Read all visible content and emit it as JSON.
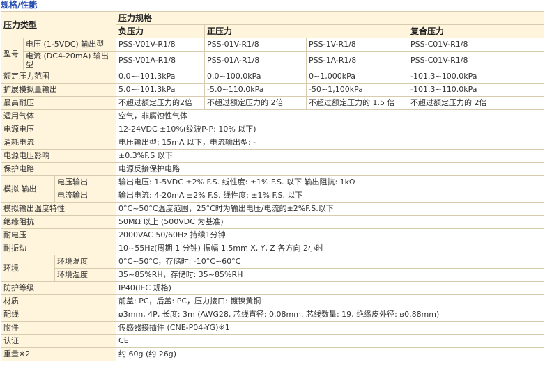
{
  "title": "规格/性能",
  "header": {
    "pressure_type": "压力类型",
    "pressure_spec": "压力规格",
    "negative": "负压力",
    "positive": "正压力",
    "compound": "复合压力"
  },
  "model": {
    "label": "型号",
    "voltage_label": "电压 (1-5VDC) 输出型",
    "current_label": "电流 (DC4-20mA) 输出型",
    "voltage": [
      "PSS-V01V-R1/8",
      "PSS-01V-R1/8",
      "PSS-1V-R1/8",
      "PSS-C01V-R1/8"
    ],
    "current": [
      "PSS-V01A-R1/8",
      "PSS-01A-R1/8",
      "PSS-1A-R1/8",
      "PSS-C01V-R1/8"
    ]
  },
  "rated_range": {
    "label": "额定压力范围",
    "values": [
      "0.0~-101.3kPa",
      "0.0~100.0kPa",
      "0~1,000kPa",
      "-101.3~100.0kPa"
    ]
  },
  "ext_output": {
    "label": "扩展模拟量输出",
    "values": [
      "5.0~-101.3kPa",
      "-5.0~110.0kPa",
      "-50~1,100kPa",
      "-101.3~110.0kPa"
    ]
  },
  "max_pressure": {
    "label": "最高耐压",
    "values": [
      "不超过额定压力的2倍",
      "不超过额定压力的 2倍",
      "不超过额定压力的 1.5 倍",
      "不超过额定压力的 2倍"
    ]
  },
  "gas": {
    "label": "适用气体",
    "value": "空气，非腐蚀性气体"
  },
  "supply_voltage": {
    "label": "电源电压",
    "value": "12-24VDC ±10%(纹波P-P: 10% 以下)"
  },
  "current_consumption": {
    "label": "消耗电流",
    "value": "电压输出型: 15mA 以下，电流输出型: -"
  },
  "supply_effect": {
    "label": "电源电压影响",
    "value": "±0.3%F.S 以下"
  },
  "protection_circuit": {
    "label": "保护电路",
    "value": "电源反接保护电路"
  },
  "analog_output": {
    "label": "模拟 输出",
    "voltage_label": "电压输出",
    "current_label": "电流输出",
    "voltage_value": "输出电压: 1-5VDC ±2% F.S. 线性度: ±1% F.S. 以下 输出阻抗: 1kΩ",
    "current_value": "输出电流: 4-20mA ±2% F.S. 线性度: ±1% F.S. 以下"
  },
  "temp_char": {
    "label": "模拟输出温度特性",
    "value": "0°C~50°C温度范围，25°C时为输出电压/电流的±2%F.S.以下"
  },
  "insulation": {
    "label": "绝缘阻抗",
    "value": "50MΩ 以上 (500VDC 为基准)"
  },
  "withstand": {
    "label": "耐电压",
    "value": "2000VAC 50/60Hz 持续1分钟"
  },
  "vibration": {
    "label": "耐振动",
    "value": "10~55Hz(周期 1 分钟) 振幅 1.5mm X, Y, Z 各方向 2小时"
  },
  "environment": {
    "label": "环境",
    "temp_label": "环境温度",
    "humidity_label": "环境湿度",
    "temp_value": "0°C~50°C，存储时: -10°C~60°C",
    "humidity_value": "35~85%RH，存储时: 35~85%RH"
  },
  "protection_grade": {
    "label": "防护等级",
    "value": "IP40(IEC 规格)"
  },
  "material": {
    "label": "材质",
    "value": "前盖: PC，后盖: PC，压力接口: 镀镍黄铜"
  },
  "wiring": {
    "label": "配线",
    "value": "ø3mm, 4P, 长度: 3m (AWG28, 芯线直径: 0.08mm. 芯线数量: 19, 绝缘皮外径: ø0.88mm)"
  },
  "accessory": {
    "label": "附件",
    "value": "传感器接插件 (CNE-P04-YG)※1"
  },
  "certification": {
    "label": "认证",
    "value": "CE"
  },
  "weight": {
    "label": "重量※2",
    "value": "约 60g (约 26g)"
  }
}
